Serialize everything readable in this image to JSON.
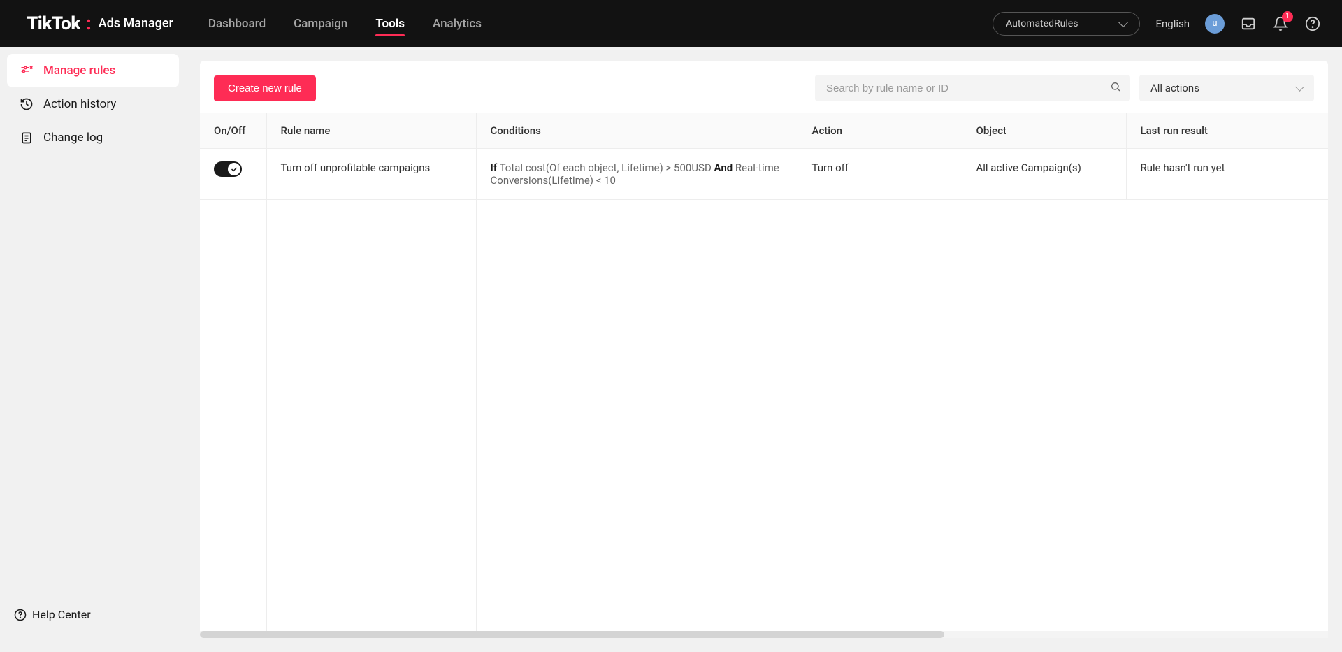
{
  "header": {
    "logo_main": "TikTok",
    "logo_sub": "Ads Manager",
    "nav": [
      "Dashboard",
      "Campaign",
      "Tools",
      "Analytics"
    ],
    "nav_active_index": 2,
    "account": "AutomatedRules",
    "language": "English",
    "avatar_letter": "u",
    "notification_count": "1"
  },
  "sidebar": {
    "items": [
      {
        "label": "Manage rules",
        "icon": "sliders"
      },
      {
        "label": "Action history",
        "icon": "history"
      },
      {
        "label": "Change log",
        "icon": "clipboard"
      }
    ],
    "active_index": 0,
    "help_center": "Help Center"
  },
  "toolbar": {
    "create_btn": "Create new rule",
    "search_placeholder": "Search by rule name or ID",
    "filter_label": "All actions"
  },
  "table": {
    "columns": [
      "On/Off",
      "Rule name",
      "Conditions",
      "Action",
      "Object",
      "Last run result"
    ],
    "rows": [
      {
        "enabled": true,
        "name": "Turn off unprofitable campaigns",
        "cond_if": "If",
        "cond_1": " Total cost(Of each object, Lifetime) > 500USD ",
        "cond_and": "And",
        "cond_2": " Real-time Conversions(Lifetime) < 10",
        "action": "Turn off",
        "object": "All active Campaign(s)",
        "result": "Rule hasn't run yet"
      }
    ]
  }
}
